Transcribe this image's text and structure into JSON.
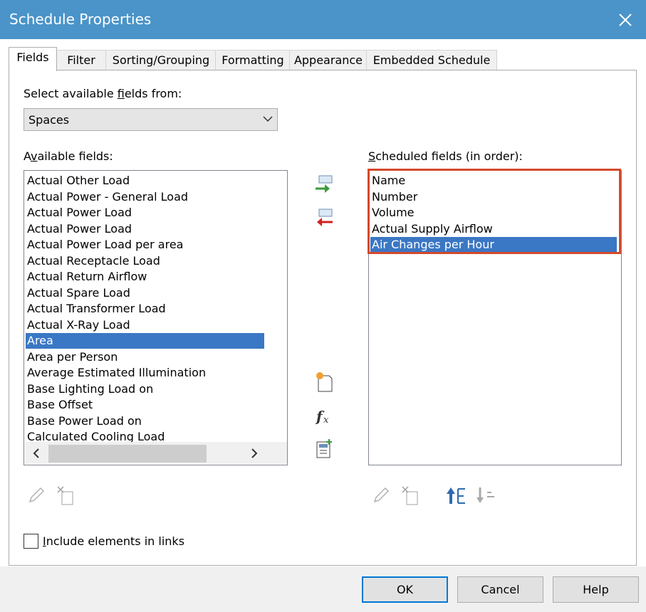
{
  "window": {
    "title": "Schedule Properties"
  },
  "tabs": [
    "Fields",
    "Filter",
    "Sorting/Grouping",
    "Formatting",
    "Appearance",
    "Embedded Schedule"
  ],
  "source": {
    "label_pre": "Select available ",
    "label_key": "f",
    "label_post": "ields from:",
    "value": "Spaces"
  },
  "available": {
    "label_pre": "A",
    "label_key": "v",
    "label_post": "ailable fields:",
    "items": [
      "Actual Other Load",
      "Actual Power - General Load",
      "Actual Power Load",
      "Actual Power Load",
      "Actual Power Load per area",
      "Actual Receptacle Load",
      "Actual Return Airflow",
      "Actual Spare Load",
      "Actual Transformer Load",
      "Actual X-Ray Load",
      "Area",
      "Area per Person",
      "Average Estimated Illumination",
      "Base Lighting Load on",
      "Base Offset",
      "Base Power Load on",
      "Calculated Cooling Load"
    ],
    "selected": "Area"
  },
  "scheduled": {
    "label_key": "S",
    "label_post": "cheduled fields (in order):",
    "items": [
      "Name",
      "Number",
      "Volume",
      "Actual Supply Airflow",
      "Air Changes per Hour"
    ],
    "selected": "Air Changes per Hour"
  },
  "include_links": {
    "key": "I",
    "label": "nclude elements in links",
    "checked": false
  },
  "buttons": {
    "ok": "OK",
    "cancel": "Cancel",
    "help": "Help"
  },
  "colors": {
    "titlebar": "#4a94c9",
    "selection": "#3a77c4",
    "highlight_box": "#d4492b"
  }
}
